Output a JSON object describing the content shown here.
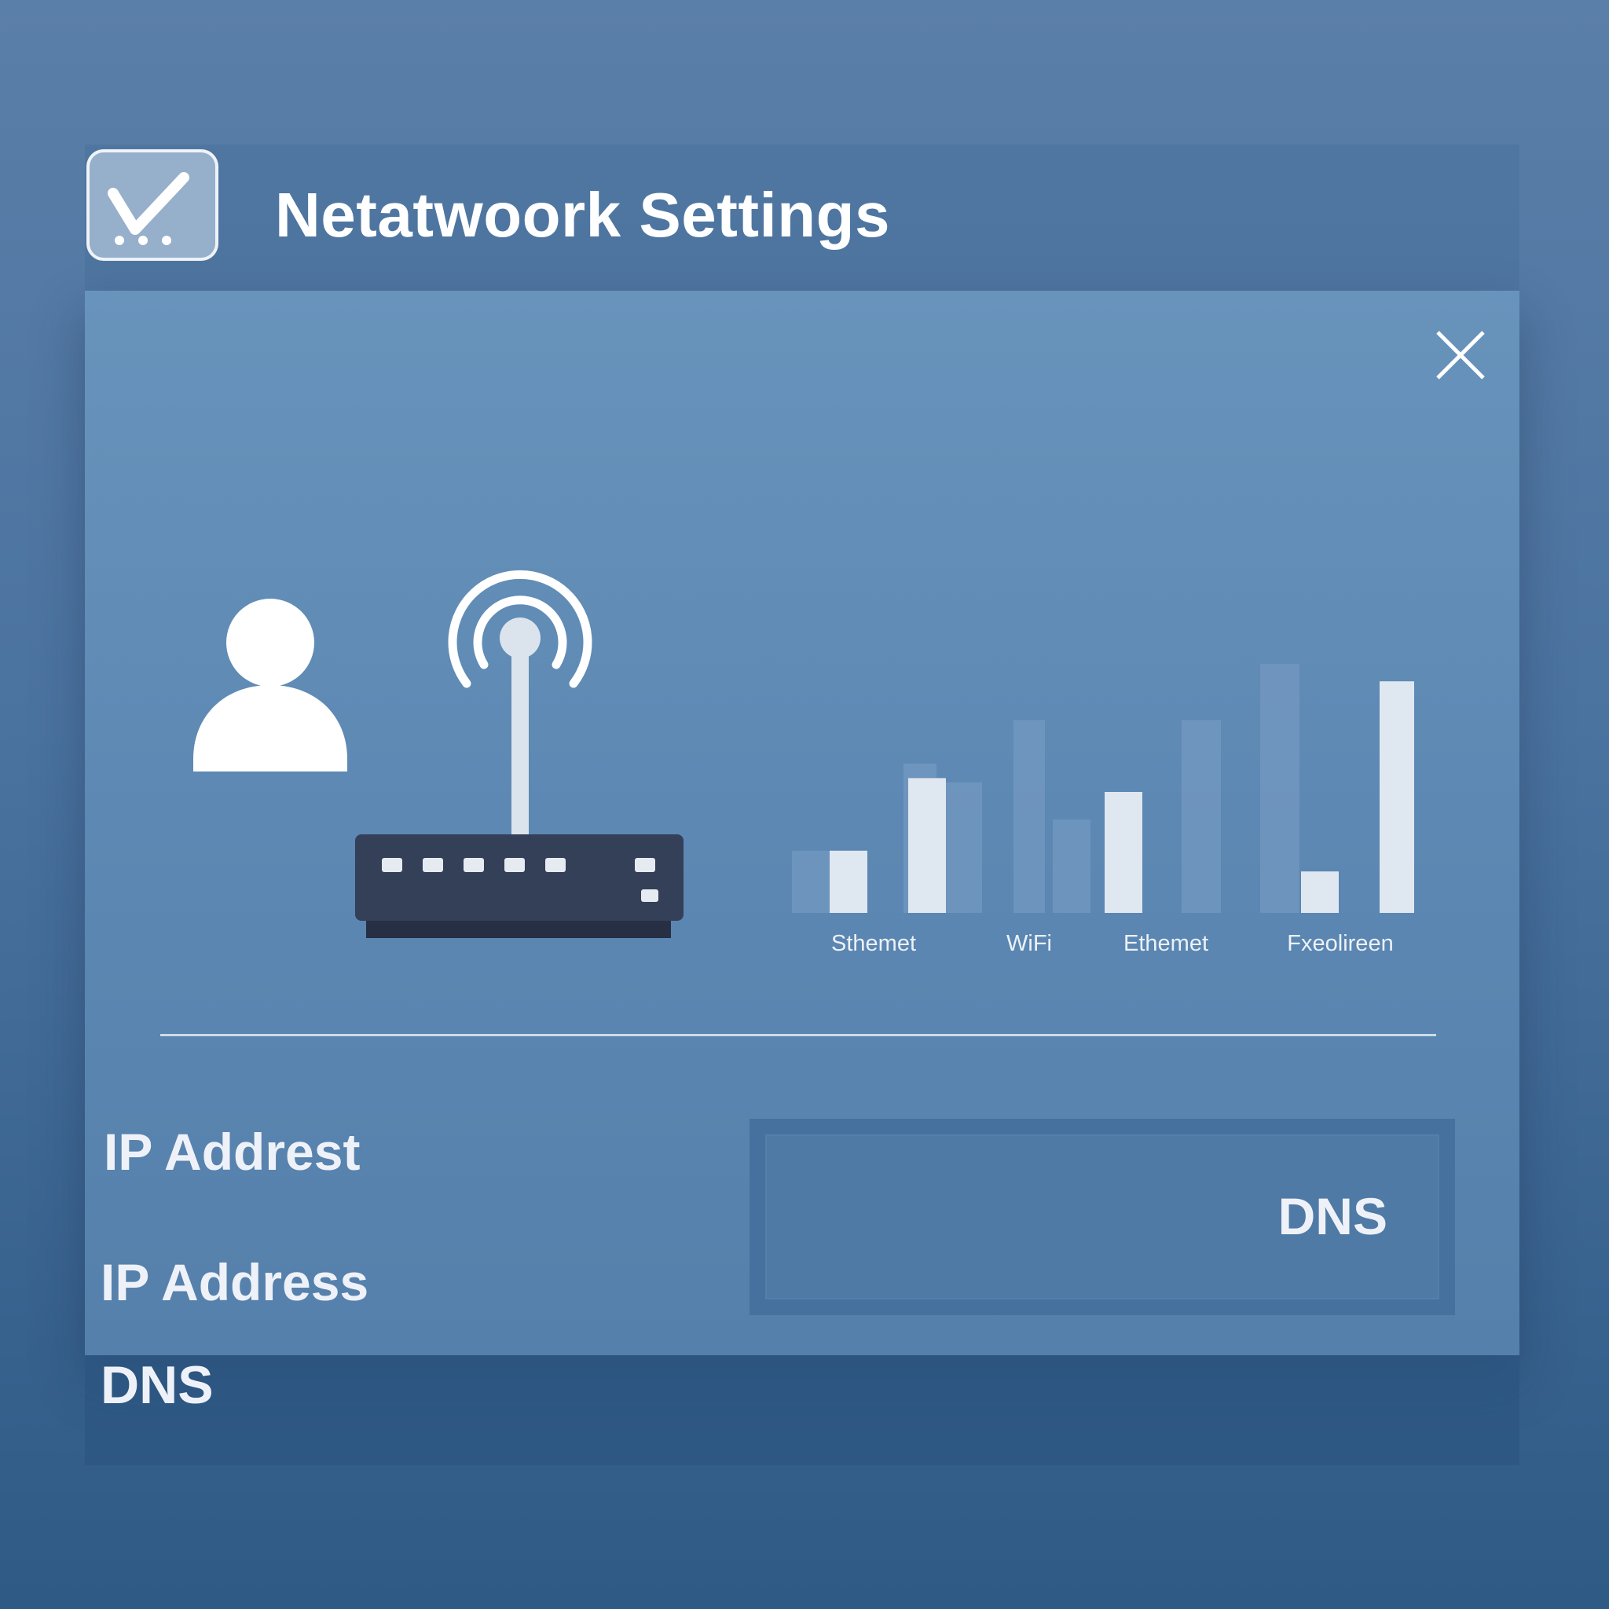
{
  "window": {
    "title": "Netatwoork Settings",
    "app_icon": "checkmark-icon",
    "close_icon": "close-icon"
  },
  "illustration": {
    "icons": [
      "user-icon",
      "router-icon"
    ]
  },
  "chart_data": {
    "type": "bar",
    "categories": [
      "Sthemet",
      "WiFi",
      "Ethemet",
      "Fxeolireen"
    ],
    "series": [
      {
        "values": [
          18,
          39,
          30,
          35,
          58,
          12,
          38,
          67,
          25,
          85
        ]
      }
    ],
    "note_label_order": [
      "Sthemet",
      "WiFi",
      "Ethemet",
      "Fxeolireen"
    ],
    "colors": {
      "bar": "#dfe7f1",
      "ghost_bar": "#7c9ec4"
    }
  },
  "fields": {
    "label_1": "IP Addrest",
    "label_2": "IP Address",
    "label_3": "DNS",
    "dns_box_label": "DNS"
  },
  "colors": {
    "background": "#4b73a0",
    "panel": "#6089b4",
    "text": "#ffffff",
    "router_body": "#333e56"
  }
}
